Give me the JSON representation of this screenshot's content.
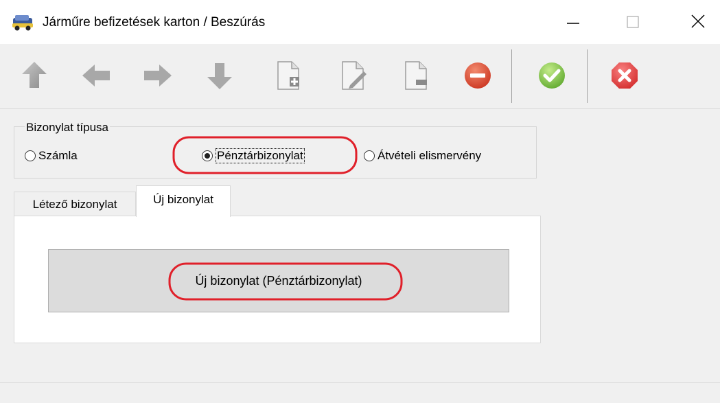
{
  "window": {
    "title": "Járműre befizetések karton / Beszúrás",
    "controls": {
      "minimize_icon": "minimize-icon",
      "maximize_icon": "maximize-icon",
      "close_icon": "close-icon"
    }
  },
  "toolbar": {
    "buttons": [
      {
        "icon": "arrow-up-icon"
      },
      {
        "icon": "arrow-left-icon"
      },
      {
        "icon": "arrow-right-icon"
      },
      {
        "icon": "arrow-down-icon"
      },
      {
        "icon": "document-add-icon"
      },
      {
        "icon": "document-edit-icon"
      },
      {
        "icon": "document-remove-icon"
      },
      {
        "icon": "delete-icon"
      },
      {
        "icon": "confirm-icon"
      },
      {
        "icon": "cancel-icon"
      }
    ],
    "colors": {
      "delete": "#d9432f",
      "confirm": "#7cc242",
      "cancel": "#e13b3b"
    }
  },
  "document_type": {
    "legend": "Bizonylat típusa",
    "options": [
      {
        "label": "Számla",
        "selected": false
      },
      {
        "label": "Pénztárbizonylat",
        "selected": true
      },
      {
        "label": "Átvételi elismervény",
        "selected": false
      }
    ]
  },
  "tabs": [
    {
      "label": "Létező bizonylat",
      "active": false
    },
    {
      "label": "Új bizonylat",
      "active": true
    }
  ],
  "new_document": {
    "button_label": "Új bizonylat (Pénztárbizonylat)"
  },
  "annotation_color": "#e0202a"
}
